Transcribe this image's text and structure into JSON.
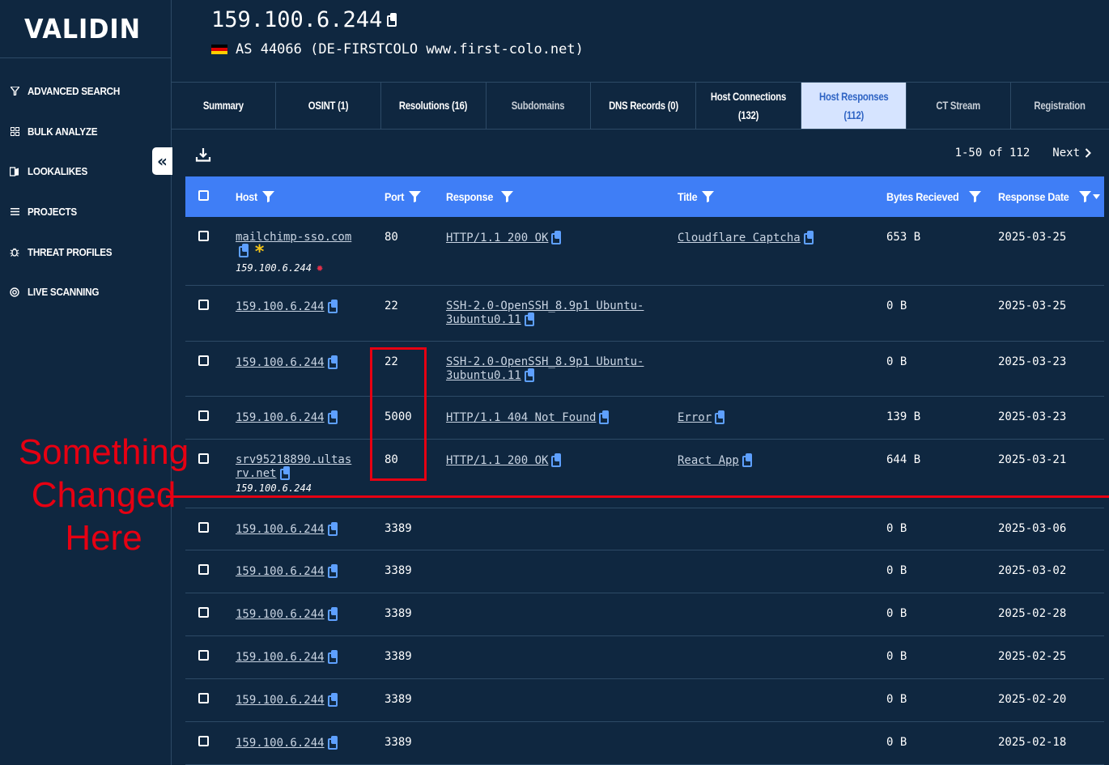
{
  "logo": "VALIDIN",
  "sidebar": {
    "items": [
      {
        "label": "ADVANCED SEARCH",
        "icon": "funnel-icon"
      },
      {
        "label": "BULK ANALYZE",
        "icon": "grid-icon"
      },
      {
        "label": "LOOKALIKES",
        "icon": "lookalikes-icon"
      },
      {
        "label": "PROJECTS",
        "icon": "list-icon"
      },
      {
        "label": "THREAT PROFILES",
        "icon": "bug-icon"
      },
      {
        "label": "LIVE SCANNING",
        "icon": "radar-icon"
      }
    ],
    "collapse_glyph": "«"
  },
  "header": {
    "ip": "159.100.6.244",
    "asn": "AS 44066 (DE-FIRSTCOLO www.first-colo.net)",
    "flag_colors": [
      "#000000",
      "#dd0000",
      "#ffce00"
    ]
  },
  "tabs": [
    {
      "line1": "Summary",
      "line2": "",
      "state": "normal"
    },
    {
      "line1": "OSINT (1)",
      "line2": "",
      "state": "normal"
    },
    {
      "line1": "Resolutions (16)",
      "line2": "",
      "state": "normal"
    },
    {
      "line1": "Subdomains",
      "line2": "",
      "state": "dim"
    },
    {
      "line1": "DNS Records (0)",
      "line2": "",
      "state": "normal"
    },
    {
      "line1": "Host Connections",
      "line2": "(132)",
      "state": "normal"
    },
    {
      "line1": "Host Responses",
      "line2": "(112)",
      "state": "active"
    },
    {
      "line1": "CT Stream",
      "line2": "",
      "state": "dim"
    },
    {
      "line1": "Registration",
      "line2": "",
      "state": "dim"
    }
  ],
  "pager": {
    "range": "1-50 of 112",
    "next": "Next"
  },
  "table": {
    "columns": [
      "Host",
      "Port",
      "Response",
      "Title",
      "Bytes Recieved",
      "Response Date"
    ],
    "rows": [
      {
        "host": "mailchimp-sso.com",
        "host_ip": "159.100.6.244",
        "port": "80",
        "response": "HTTP/1.1 200 OK",
        "response2": "",
        "title": "Cloudflare Captcha",
        "bytes": "653 B",
        "date": "2025-03-25"
      },
      {
        "host": "159.100.6.244",
        "host_ip": "",
        "port": "22",
        "response": "SSH-2.0-OpenSSH_8.9p1 Ubuntu-",
        "response2": "3ubuntu0.11",
        "title": "",
        "bytes": "0 B",
        "date": "2025-03-25"
      },
      {
        "host": "159.100.6.244",
        "host_ip": "",
        "port": "22",
        "response": "SSH-2.0-OpenSSH_8.9p1 Ubuntu-",
        "response2": "3ubuntu0.11",
        "title": "",
        "bytes": "0 B",
        "date": "2025-03-23"
      },
      {
        "host": "159.100.6.244",
        "host_ip": "",
        "port": "5000",
        "response": "HTTP/1.1 404 Not Found",
        "response2": "",
        "title": "Error",
        "bytes": "139 B",
        "date": "2025-03-23"
      },
      {
        "host": "srv95218890.ultas",
        "host2": "rv.net",
        "host_ip": "159.100.6.244",
        "port": "80",
        "response": "HTTP/1.1 200 OK",
        "response2": "",
        "title": "React App",
        "bytes": "644 B",
        "date": "2025-03-21"
      },
      {
        "host": "159.100.6.244",
        "host_ip": "",
        "port": "3389",
        "response": "",
        "response2": "",
        "title": "",
        "bytes": "0 B",
        "date": "2025-03-06"
      },
      {
        "host": "159.100.6.244",
        "host_ip": "",
        "port": "3389",
        "response": "",
        "response2": "",
        "title": "",
        "bytes": "0 B",
        "date": "2025-03-02"
      },
      {
        "host": "159.100.6.244",
        "host_ip": "",
        "port": "3389",
        "response": "",
        "response2": "",
        "title": "",
        "bytes": "0 B",
        "date": "2025-02-28"
      },
      {
        "host": "159.100.6.244",
        "host_ip": "",
        "port": "3389",
        "response": "",
        "response2": "",
        "title": "",
        "bytes": "0 B",
        "date": "2025-02-25"
      },
      {
        "host": "159.100.6.244",
        "host_ip": "",
        "port": "3389",
        "response": "",
        "response2": "",
        "title": "",
        "bytes": "0 B",
        "date": "2025-02-20"
      },
      {
        "host": "159.100.6.244",
        "host_ip": "",
        "port": "3389",
        "response": "",
        "response2": "",
        "title": "",
        "bytes": "0 B",
        "date": "2025-02-18"
      }
    ]
  },
  "annotation": {
    "lines": [
      "Something",
      "Changed",
      "Here"
    ],
    "color": "#e60012"
  },
  "colors": {
    "background": "#0f2740",
    "header_row": "#3f7ef6",
    "active_tab": "#d6e4ff",
    "copy_icon": "#5ea0ff",
    "star": "#f5c518",
    "threat": "#e0304a"
  }
}
